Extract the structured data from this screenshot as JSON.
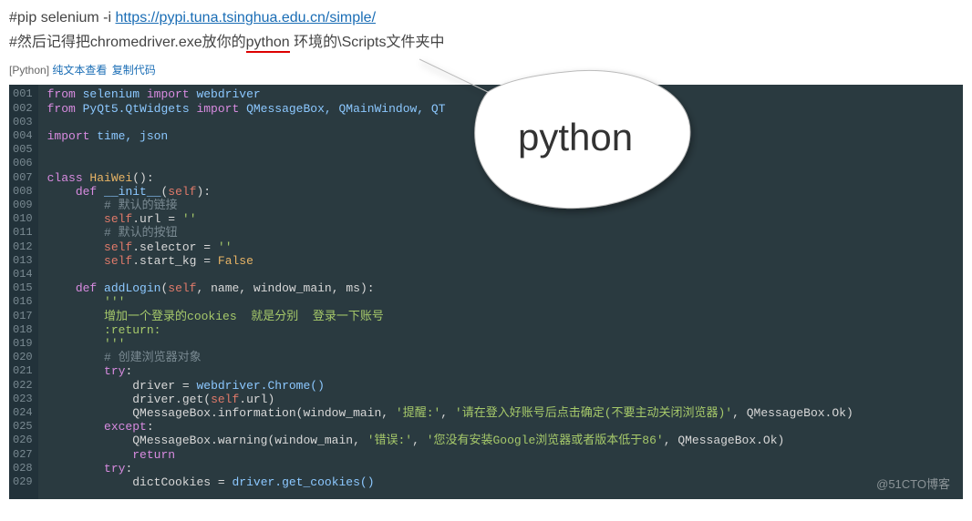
{
  "header": {
    "hash1": "#",
    "pip_prefix": "pip selenium -i ",
    "pip_url": "https://pypi.tuna.tsinghua.edu.cn/simple/",
    "hash2": "#",
    "note_before": "然后记得把chromedriver.exe放你的",
    "note_underlined": "python",
    "note_after": " 环境的\\Scripts文件夹中"
  },
  "toolbar": {
    "lang_tag": "[Python] ",
    "plain_view": "纯文本查看",
    "copy_code": " 复制代码"
  },
  "callout_word": "python",
  "code": {
    "line_numbers": [
      "001",
      "002",
      "003",
      "004",
      "005",
      "006",
      "007",
      "008",
      "009",
      "010",
      "011",
      "012",
      "013",
      "014",
      "015",
      "016",
      "017",
      "018",
      "019",
      "020",
      "021",
      "022",
      "023",
      "024",
      "025",
      "026",
      "027",
      "028",
      "029"
    ],
    "l1_kw1": "from",
    "l1_id1": " selenium ",
    "l1_kw2": "import",
    "l1_id2": " webdriver",
    "l2_kw1": "from",
    "l2_id1": " PyQt5.QtWidgets ",
    "l2_kw2": "import",
    "l2_id2": " QMessageBox, QMainWindow, QT",
    "l4_kw": "import",
    "l4_id": " time, json",
    "l7_kw": "class",
    "l7_name": " HaiWei",
    "l7_rest": "():",
    "l8_indent": "    ",
    "l8_kw": "def",
    "l8_sp": " ",
    "l8_fn": "__init__",
    "l8_p1": "(",
    "l8_self": "self",
    "l8_p2": "):",
    "l9_indent": "        ",
    "l9_cm": "# 默认的链接",
    "l10_indent": "        ",
    "l10_self": "self",
    "l10_rest": ".url ",
    "l10_op": "=",
    "l10_sp": " ",
    "l10_str": "''",
    "l11_indent": "        ",
    "l11_cm": "# 默认的按钮",
    "l12_indent": "        ",
    "l12_self": "self",
    "l12_rest": ".selector ",
    "l12_op": "=",
    "l12_sp": " ",
    "l12_str": "''",
    "l13_indent": "        ",
    "l13_self": "self",
    "l13_rest": ".start_kg ",
    "l13_op": "=",
    "l13_sp": " ",
    "l13_val": "False",
    "l15_indent": "    ",
    "l15_kw": "def",
    "l15_sp": " ",
    "l15_fn": "addLogin",
    "l15_p1": "(",
    "l15_self": "self",
    "l15_args": ", name, window_main, ms",
    "l15_p2": "):",
    "l16_indent": "        ",
    "l16_str": "'''",
    "l17_indent": "        ",
    "l17_str": "增加一个登录的cookies  就是分别  登录一下账号",
    "l18_indent": "        ",
    "l18_str": ":return:",
    "l19_indent": "        ",
    "l19_str": "'''",
    "l20_indent": "        ",
    "l20_cm": "# 创建浏览器对象",
    "l21_indent": "        ",
    "l21_kw": "try",
    "l21_colon": ":",
    "l22_indent": "            ",
    "l22_txt": "driver ",
    "l22_op": "=",
    "l22_sp": " ",
    "l22_call": "webdriver.Chrome()",
    "l23_indent": "            ",
    "l23_txt": "driver.get(",
    "l23_self": "self",
    "l23_rest": ".url)",
    "l24_indent": "            ",
    "l24_txt": "QMessageBox.information(window_main, ",
    "l24_s1": "'提醒:'",
    "l24_c1": ", ",
    "l24_s2": "'请在登入好账号后点击确定(不要主动关闭浏览器)'",
    "l24_c2": ", QMessageBox.Ok)",
    "l25_indent": "        ",
    "l25_kw": "except",
    "l25_colon": ":",
    "l26_indent": "            ",
    "l26_txt": "QMessageBox.warning(window_main, ",
    "l26_s1": "'错误:'",
    "l26_c1": ", ",
    "l26_s2": "'您没有安装Google浏览器或者版本低于86'",
    "l26_c2": ", QMessageBox.Ok)",
    "l27_indent": "            ",
    "l27_kw": "return",
    "l28_indent": "        ",
    "l28_kw": "try",
    "l28_colon": ":",
    "l29_indent": "            ",
    "l29_txt": "dictCookies ",
    "l29_op": "=",
    "l29_sp": " ",
    "l29_call": "driver.get_cookies()"
  },
  "watermark": "@51CTO博客"
}
